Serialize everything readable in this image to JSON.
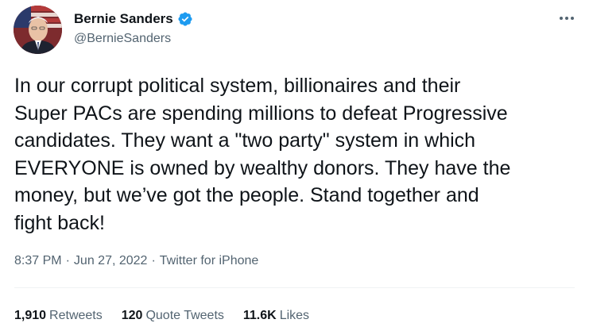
{
  "author": {
    "display_name": "Bernie Sanders",
    "handle": "@BernieSanders",
    "verified": true,
    "avatar_icon": "profile-photo"
  },
  "menu": {
    "icon": "more-horizontal-icon"
  },
  "tweet": {
    "text": "In our corrupt political system, billionaires and their\nSuper PACs are spending millions to defeat Progressive\ncandidates. They want a \"two party\" system in which\nEVERYONE is owned by wealthy donors. They have the\nmoney, but we’ve got the people. Stand together and\nfight back!"
  },
  "meta": {
    "time": "8:37 PM",
    "separator": "·",
    "date": "Jun 27, 2022",
    "source": "Twitter for iPhone"
  },
  "stats": {
    "retweets": {
      "count": "1,910",
      "label": "Retweets"
    },
    "quote_tweets": {
      "count": "120",
      "label": "Quote Tweets"
    },
    "likes": {
      "count": "11.6K",
      "label": "Likes"
    }
  },
  "colors": {
    "text_primary": "#0f1419",
    "text_secondary": "#536471",
    "verified_blue": "#1d9bf0",
    "divider": "#eff3f4"
  }
}
